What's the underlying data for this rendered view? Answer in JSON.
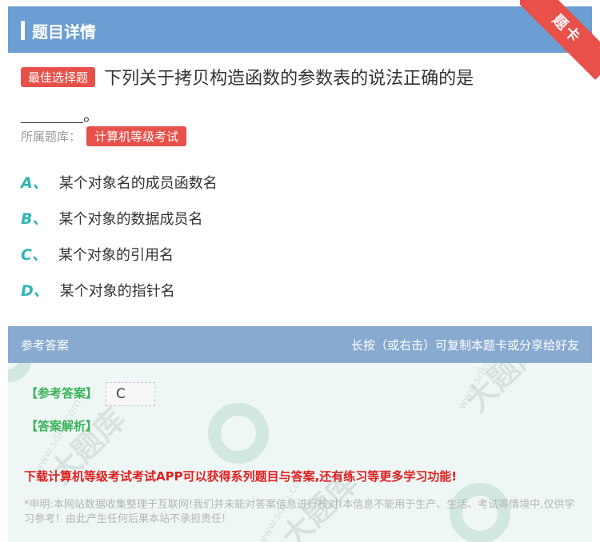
{
  "header": {
    "title": "题目详情",
    "ribbon": "题卡"
  },
  "question": {
    "type_badge": "最佳选择题",
    "text": "下列关于拷贝构造函数的参数表的说法正确的是",
    "blank_suffix": "。",
    "bank_label": "所属题库：",
    "bank_name": "计算机等级考试"
  },
  "options": [
    {
      "letter": "A、",
      "text": "某个对象名的成员函数名"
    },
    {
      "letter": "B、",
      "text": "某个对象的数据成员名"
    },
    {
      "letter": "C、",
      "text": "某个对象的引用名"
    },
    {
      "letter": "D、",
      "text": "某个对象的指针名"
    }
  ],
  "answer_section": {
    "title": "参考答案",
    "hint": "长按（或右击）可复制本题卡或分享给好友",
    "ref_label": "【参考答案】",
    "ref_value": "C",
    "analysis_label": "【答案解析】",
    "promo": "下载计算机等级考试考试APP可以获得系列题目与答案,还有练习等更多学习功能!",
    "disclaimer": "*申明:本网站数据收集整理于互联网!我们并未能对答案信息进行核对!本信息不能用于生产、生活、考试等情境中,仅供学习参考！由此产生任何后果本站不承担责任!"
  },
  "colors": {
    "header_bg": "#6b9ed2",
    "answer_bar_bg": "#88aad0",
    "badge_red": "#e8504a",
    "option_letter": "#2fb5b6",
    "answer_green": "#3bb25a",
    "promo_red": "#e02020"
  }
}
